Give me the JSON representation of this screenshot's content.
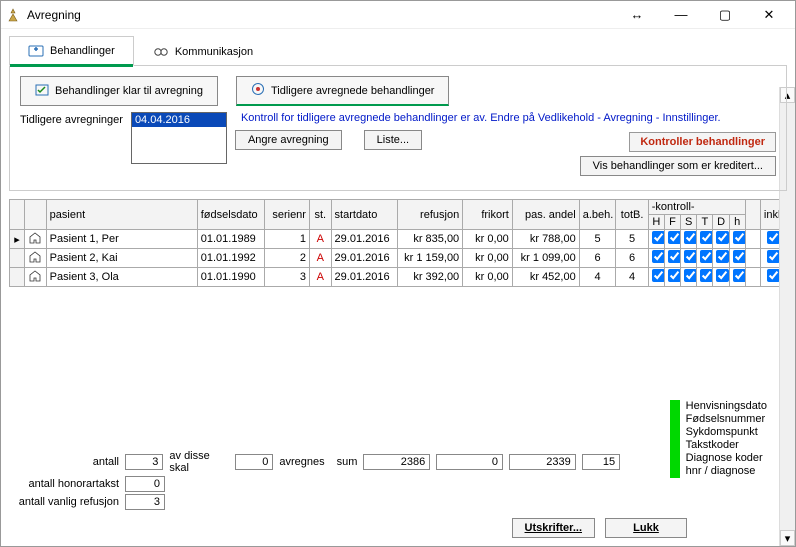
{
  "window": {
    "title": "Avregning"
  },
  "tabs": {
    "treatments": "Behandlinger",
    "communication": "Kommunikasjon"
  },
  "subtabs": {
    "ready": "Behandlinger klar til avregning",
    "previous": "Tidligere avregnede behandlinger"
  },
  "controls": {
    "prev_label": "Tidligere avregninger",
    "selected_date": "04.04.2016",
    "info_msg": "Kontroll for tidligere avregnede behandlinger er av. Endre på Vedlikehold - Avregning - Innstillinger.",
    "kontroller": "Kontroller behandlinger",
    "angre": "Angre avregning",
    "liste": "Liste...",
    "vis_kreditert": "Vis behandlinger som er kreditert..."
  },
  "grid": {
    "group_kontroll": "-kontroll-",
    "headers": {
      "pasient": "pasient",
      "fodselsdato": "fødselsdato",
      "serienr": "serienr",
      "st": "st.",
      "startdato": "startdato",
      "refusjon": "refusjon",
      "frikort": "frikort",
      "pas_andel": "pas. andel",
      "abeh": "a.beh.",
      "totb": "totB.",
      "H": "H",
      "F": "F",
      "S": "S",
      "T": "T",
      "D": "D",
      "hh": "h",
      "inkl": "inkl."
    },
    "rows": [
      {
        "pasient": "Pasient 1, Per",
        "fodselsdato": "01.01.1989",
        "serienr": "1",
        "st": "A",
        "startdato": "29.01.2016",
        "refusjon": "kr 835,00",
        "frikort": "kr 0,00",
        "pas_andel": "kr 788,00",
        "abeh": "5",
        "totb": "5",
        "H": true,
        "F": true,
        "S": true,
        "T": true,
        "D": true,
        "hh": true,
        "inkl": true
      },
      {
        "pasient": "Pasient 2, Kai",
        "fodselsdato": "01.01.1992",
        "serienr": "2",
        "st": "A",
        "startdato": "29.01.2016",
        "refusjon": "kr 1 159,00",
        "frikort": "kr 0,00",
        "pas_andel": "kr 1 099,00",
        "abeh": "6",
        "totb": "6",
        "H": true,
        "F": true,
        "S": true,
        "T": true,
        "D": true,
        "hh": true,
        "inkl": true
      },
      {
        "pasient": "Pasient 3, Ola",
        "fodselsdato": "01.01.1990",
        "serienr": "3",
        "st": "A",
        "startdato": "29.01.2016",
        "refusjon": "kr 392,00",
        "frikort": "kr 0,00",
        "pas_andel": "kr 452,00",
        "abeh": "4",
        "totb": "4",
        "H": true,
        "F": true,
        "S": true,
        "T": true,
        "D": true,
        "hh": true,
        "inkl": true
      }
    ]
  },
  "summary": {
    "antall_label": "antall",
    "antall": "3",
    "av_disse": "av disse skal",
    "avregnes_count": "0",
    "avregnes_label": "avregnes",
    "honorar_label": "antall honorartakst",
    "honorar": "0",
    "vanlig_label": "antall vanlig refusjon",
    "vanlig": "3",
    "sum_label": "sum",
    "sum_refusjon": "2386",
    "sum_frikort": "0",
    "sum_pas": "2339",
    "sum_beh": "15"
  },
  "legend": {
    "items": [
      "Henvisningsdato",
      "Fødselsnummer",
      "Sykdomspunkt",
      "Takstkoder",
      "Diagnose koder",
      "hnr / diagnose"
    ]
  },
  "footer": {
    "utskrifter": "Utskrifter...",
    "lukk": "Lukk"
  }
}
